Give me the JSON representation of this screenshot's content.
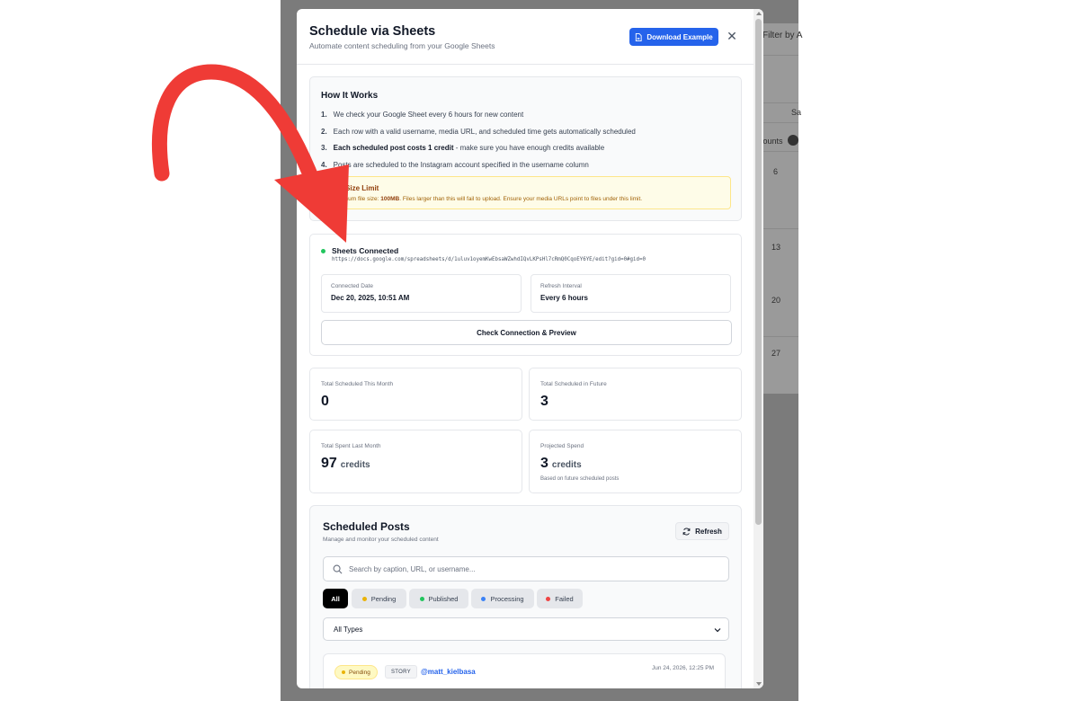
{
  "background": {
    "filter_label": "Filter by A",
    "col_label": "Sa",
    "accounts_label": "counts",
    "day_numbers": [
      "6",
      "13",
      "20",
      "27"
    ]
  },
  "modal": {
    "title": "Schedule via Sheets",
    "subtitle": "Automate content scheduling from your Google Sheets",
    "download_label": "Download Example",
    "close_icon": "close-icon"
  },
  "how_it_works": {
    "title": "How It Works",
    "steps": [
      {
        "num": "1.",
        "bold": "",
        "text": "We check your Google Sheet every 6 hours for new content"
      },
      {
        "num": "2.",
        "bold": "",
        "text": "Each row with a valid username, media URL, and scheduled time gets automatically scheduled"
      },
      {
        "num": "3.",
        "bold": "Each scheduled post costs 1 credit",
        "text": " - make sure you have enough credits available"
      },
      {
        "num": "4.",
        "bold": "",
        "text": "Posts are scheduled to the Instagram account specified in the username column"
      }
    ],
    "warning_title": "File Size Limit",
    "warning_prefix": "Maximum file size: ",
    "warning_bold": "100MB",
    "warning_suffix": ". Files larger than this will fail to upload. Ensure your media URLs point to files under this limit."
  },
  "connection": {
    "status": "Sheets Connected",
    "url": "https://docs.google.com/spreadsheets/d/1uluv1oyemKwEbsaWZwhdIQvLKPsHl7cRmQ0CqoEY6YE/edit?gid=0#gid=0",
    "connected_date_label": "Connected Date",
    "connected_date": "Dec 20, 2025, 10:51 AM",
    "refresh_interval_label": "Refresh Interval",
    "refresh_interval": "Every 6 hours",
    "check_button": "Check Connection & Preview",
    "status_color": "#22c55e"
  },
  "stats": {
    "this_month_label": "Total Scheduled This Month",
    "this_month_value": "0",
    "future_label": "Total Scheduled in Future",
    "future_value": "3",
    "spent_label": "Total Spent Last Month",
    "spent_value": "97",
    "spent_unit": "credits",
    "projected_label": "Projected Spend",
    "projected_value": "3",
    "projected_unit": "credits",
    "projected_note": "Based on future scheduled posts"
  },
  "scheduled_posts": {
    "title": "Scheduled Posts",
    "subtitle": "Manage and monitor your scheduled content",
    "refresh_label": "Refresh",
    "search_placeholder": "Search by caption, URL, or username...",
    "filters": [
      {
        "label": "All",
        "color": ""
      },
      {
        "label": "Pending",
        "color": "#eab308"
      },
      {
        "label": "Published",
        "color": "#22c55e"
      },
      {
        "label": "Processing",
        "color": "#3b82f6"
      },
      {
        "label": "Failed",
        "color": "#ef4444"
      }
    ],
    "type_select": "All Types",
    "posts": [
      {
        "status": "Pending",
        "type": "STORY",
        "username": "@matt_kielbasa",
        "date": "Jun 24, 2026, 12:25 PM"
      }
    ]
  },
  "colors": {
    "accent": "#2563eb",
    "annotation_arrow": "#ef3b36"
  }
}
